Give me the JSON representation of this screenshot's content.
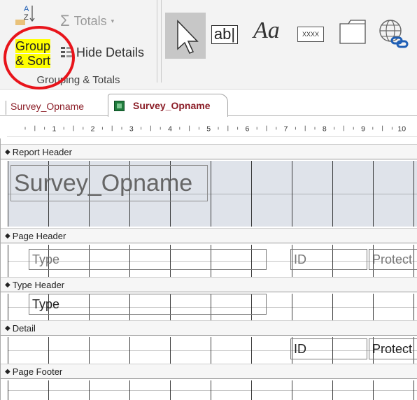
{
  "ribbon": {
    "totals_label": "Totals",
    "group_sort_line1": "Group",
    "group_sort_line2": "& Sort",
    "hide_details_label": "Hide Details",
    "group_caption": "Grouping & Totals",
    "textbox_glyph": "ab|",
    "label_glyph": "Aa",
    "button_glyph": "XXXX",
    "sort_icon": "sort-az-icon",
    "hide_details_icon": "hide-details-icon"
  },
  "tabs": [
    {
      "label": "Survey_Opname"
    },
    {
      "label": "Survey_Opname"
    }
  ],
  "ruler": {
    "numbers": [
      "1",
      "2",
      "3",
      "4",
      "5",
      "6",
      "7",
      "8",
      "9",
      "10"
    ]
  },
  "bands": {
    "report_header": "Report Header",
    "page_header": "Page Header",
    "type_header": "Type Header",
    "detail": "Detail",
    "page_footer": "Page Footer"
  },
  "controls": {
    "report_title": "Survey_Opname",
    "page_header_type": "Type",
    "page_header_id": "ID",
    "page_header_protect": "Protect",
    "type_header_type": "Type",
    "detail_id": "ID",
    "detail_protect": "Protect"
  },
  "colors": {
    "highlight": "#ffff00",
    "annotation": "#e8141b",
    "tab_text": "#8b1d27",
    "report_header_fill": "#dfe3ea"
  }
}
